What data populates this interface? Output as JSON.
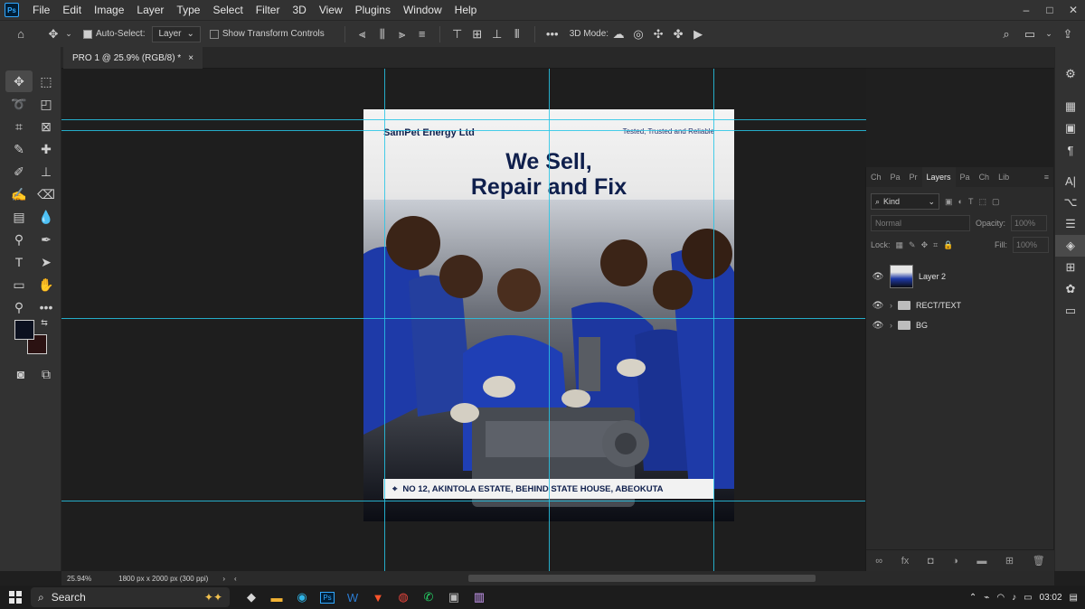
{
  "menubar": {
    "logo": "Ps",
    "items": [
      "File",
      "Edit",
      "Image",
      "Layer",
      "Type",
      "Select",
      "Filter",
      "3D",
      "View",
      "Plugins",
      "Window",
      "Help"
    ],
    "window_controls": [
      "–",
      "□",
      "✕"
    ]
  },
  "options": {
    "auto_select_label": "Auto-Select:",
    "auto_select_value": "Layer",
    "transform_label": "Show Transform Controls",
    "mode_label": "3D Mode:"
  },
  "document": {
    "tab_title": "PRO 1 @ 25.9% (RGB/8) *",
    "close": "×"
  },
  "poster": {
    "brand": "SamPet Energy Ltd",
    "tagline": "Tested, Trusted and Reliable",
    "headline_line1": "We Sell,",
    "headline_line2": "Repair and Fix",
    "address": "NO 12, AKINTOLA ESTATE, BEHIND STATE HOUSE, ABEOKUTA"
  },
  "layers_panel": {
    "tabs": [
      "Ch",
      "Pa",
      "Pr",
      "Layers",
      "Pa",
      "Ch",
      "Lib"
    ],
    "active_tab": "Layers",
    "kind_label": "Kind",
    "blend_mode": "Normal",
    "opacity_label": "Opacity:",
    "opacity_value": "100%",
    "lock_label": "Lock:",
    "fill_label": "Fill:",
    "fill_value": "100%",
    "layers": [
      {
        "name": "Layer 2"
      },
      {
        "name": "RECT/TEXT"
      },
      {
        "name": "BG"
      }
    ]
  },
  "status": {
    "zoom": "25.94%",
    "doc_info": "1800 px x 2000 px (300 ppi)"
  },
  "taskbar": {
    "search_label": "Search",
    "time": "03:02"
  },
  "colors": {
    "accent_guides": "#27c6e6",
    "brand_navy": "#0f1f4c",
    "uniform_blue": "#1e3aa8"
  }
}
